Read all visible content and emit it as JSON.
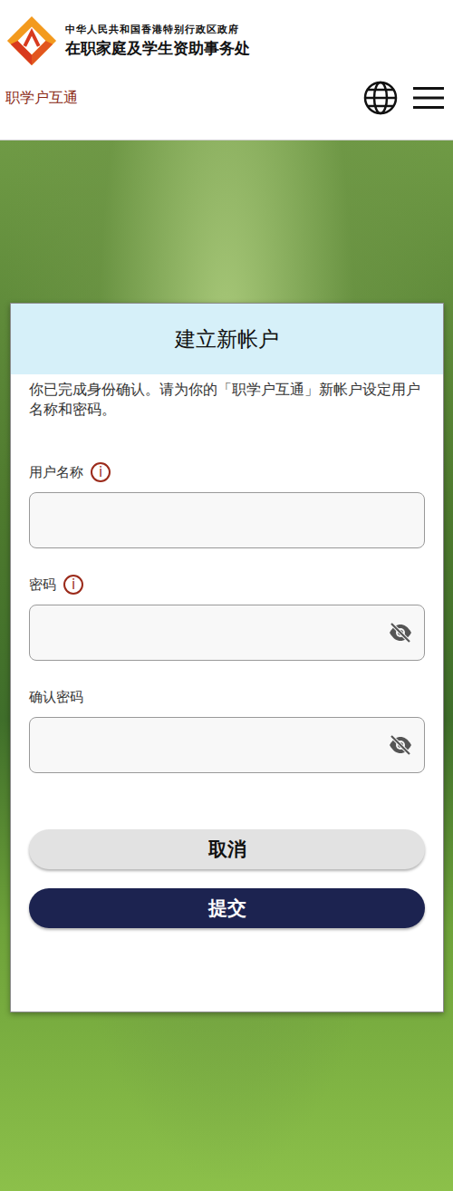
{
  "header": {
    "org_line": "中华人民共和国香港特别行政区政府",
    "office_line": "在职家庭及学生资助事务处"
  },
  "nav": {
    "title": "职学户互通"
  },
  "card": {
    "title": "建立新帐户",
    "intro": "你已完成身份确认。请为你的「职学户互通」新帐户设定用户名称和密码。"
  },
  "fields": [
    {
      "label": "用户名称",
      "kind": "text",
      "info": "i",
      "value": "",
      "masked": false
    },
    {
      "label": "密码",
      "kind": "password",
      "info": "i",
      "value": "",
      "masked": true
    },
    {
      "label": "确认密码",
      "kind": "password",
      "info": "",
      "value": "",
      "masked": true
    }
  ],
  "buttons": [
    {
      "label": "取消",
      "kind": "secondary"
    },
    {
      "label": "提交",
      "kind": "primary"
    }
  ]
}
